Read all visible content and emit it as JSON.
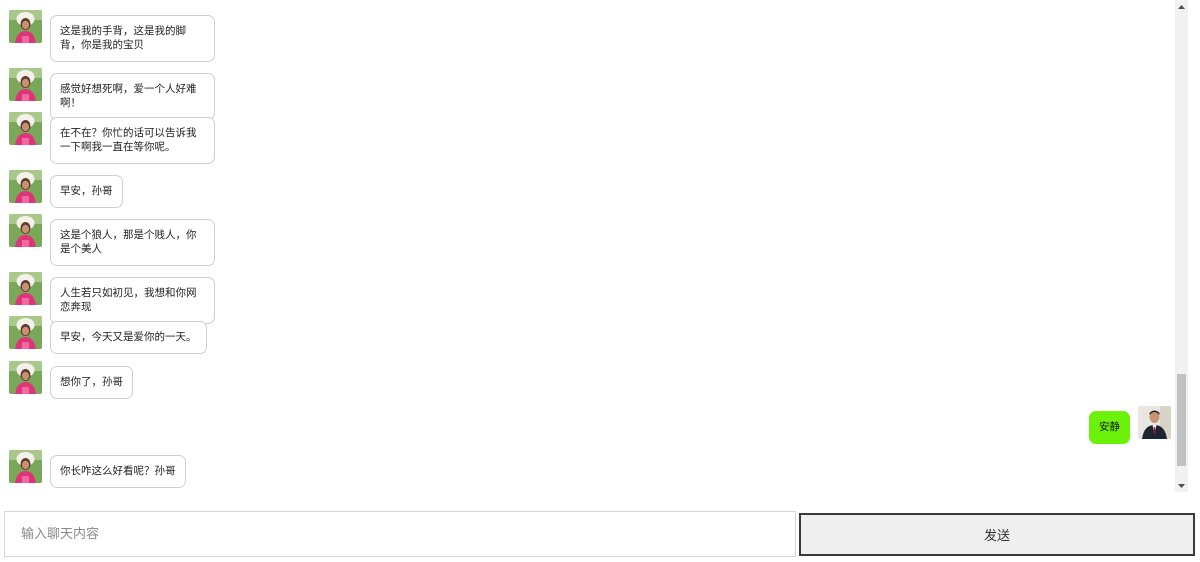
{
  "messages": [
    {
      "side": "left",
      "text": "这是我的手背，这是我的脚背，你是我的宝贝"
    },
    {
      "side": "left",
      "text": "感觉好想死啊，爱一个人好难啊！"
    },
    {
      "side": "left",
      "text": "在不在？你忙的话可以告诉我一下啊我一直在等你呢。"
    },
    {
      "side": "left",
      "text": "早安，孙哥"
    },
    {
      "side": "left",
      "text": "这是个狼人，那是个贱人，你是个美人"
    },
    {
      "side": "left",
      "text": "人生若只如初见，我想和你网恋奔现"
    },
    {
      "side": "left",
      "text": "早安，今天又是爱你的一天。"
    },
    {
      "side": "left",
      "text": "想你了，孙哥"
    },
    {
      "side": "right",
      "text": "安静"
    },
    {
      "side": "left",
      "text": "你长咋这么好看呢？孙哥"
    }
  ],
  "avatars": {
    "left": "girl-avatar",
    "right": "man-avatar"
  },
  "colors": {
    "my_bubble": "#6cf20a",
    "other_bubble_border": "#cfcfcf"
  },
  "input": {
    "placeholder": "输入聊天内容",
    "value": ""
  },
  "send_label": "发送"
}
